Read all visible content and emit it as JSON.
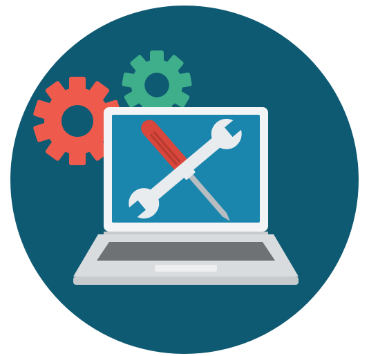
{
  "illustration": {
    "subject": "laptop-maintenance-icon",
    "colors": {
      "background": "#ffffff",
      "circle": "#0e5a72",
      "gear_primary": "#ee5b4c",
      "gear_secondary": "#3fae8a",
      "laptop_frame": "#f2f4f5",
      "laptop_screen": "#1a86ad",
      "keyboard_panel": "#6e7275",
      "base_body": "#d9dcde",
      "base_lip": "#c7cbce",
      "trackpad": "#eceeef",
      "tool_metal": "#e9ecee",
      "screwdriver_handle": "#d9463b",
      "screwdriver_shaft": "#b8bdc1"
    },
    "icons": [
      "gear-icon",
      "gear-icon",
      "laptop-icon",
      "wrench-icon",
      "screwdriver-icon"
    ]
  }
}
